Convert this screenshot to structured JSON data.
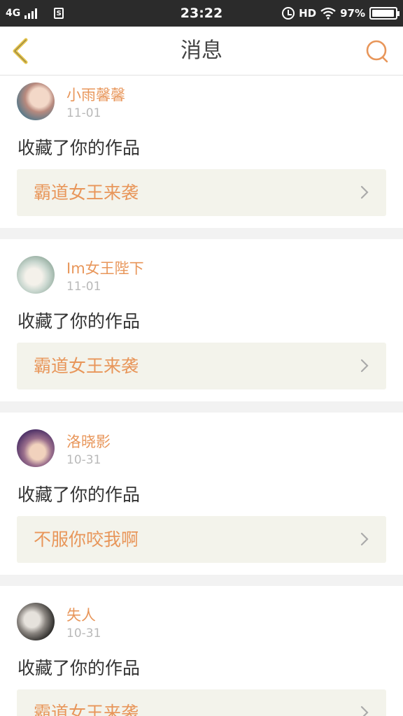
{
  "status_bar": {
    "network": "4G",
    "time": "23:22",
    "hd": "HD",
    "battery_percent": "97%",
    "battery_level": 0.97
  },
  "header": {
    "title": "消息",
    "back_icon": "chevron-left-icon",
    "search_icon": "search-icon",
    "accent_color": "#e8965a",
    "back_color": "#e5c44a"
  },
  "messages": [
    {
      "username": "小雨馨馨",
      "date": "11-01",
      "action": "收藏了你的作品",
      "work_title": "霸道女王来袭"
    },
    {
      "username": "Im女王陛下",
      "date": "11-01",
      "action": "收藏了你的作品",
      "work_title": "霸道女王来袭"
    },
    {
      "username": "洛晓影",
      "date": "10-31",
      "action": "收藏了你的作品",
      "work_title": "不服你咬我啊"
    },
    {
      "username": "失人",
      "date": "10-31",
      "action": "收藏了你的作品",
      "work_title": "霸道女王来袭"
    }
  ]
}
